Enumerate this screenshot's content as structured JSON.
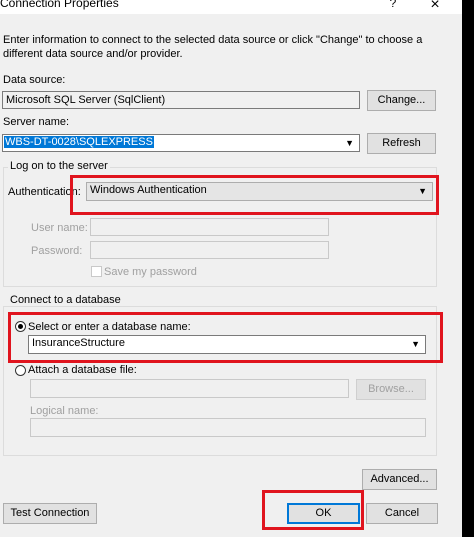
{
  "window": {
    "title": "Connection Properties",
    "help_label": "?",
    "close_label": "×"
  },
  "instruction": "Enter information to connect to the selected data source or click \"Change\" to choose a different data source and/or provider.",
  "data_source": {
    "label": "Data source:",
    "value": "Microsoft SQL Server (SqlClient)",
    "change_label": "Change..."
  },
  "server": {
    "label": "Server name:",
    "value": "WBS-DT-0028\\SQLEXPRESS",
    "refresh_label": "Refresh"
  },
  "logon": {
    "legend": "Log on to the server",
    "auth_label": "Authentication:",
    "auth_value": "Windows Authentication",
    "user_label": "User name:",
    "password_label": "Password:",
    "save_password_label": "Save my password"
  },
  "database": {
    "legend": "Connect to a database",
    "select_label": "Select or enter a database name:",
    "db_value": "InsuranceStructure",
    "attach_label": "Attach a database file:",
    "browse_label": "Browse...",
    "logical_label": "Logical name:"
  },
  "buttons": {
    "advanced": "Advanced...",
    "test": "Test Connection",
    "ok": "OK",
    "cancel": "Cancel"
  },
  "accent": {
    "highlight": "#e0141e",
    "selection": "#0078d7"
  }
}
